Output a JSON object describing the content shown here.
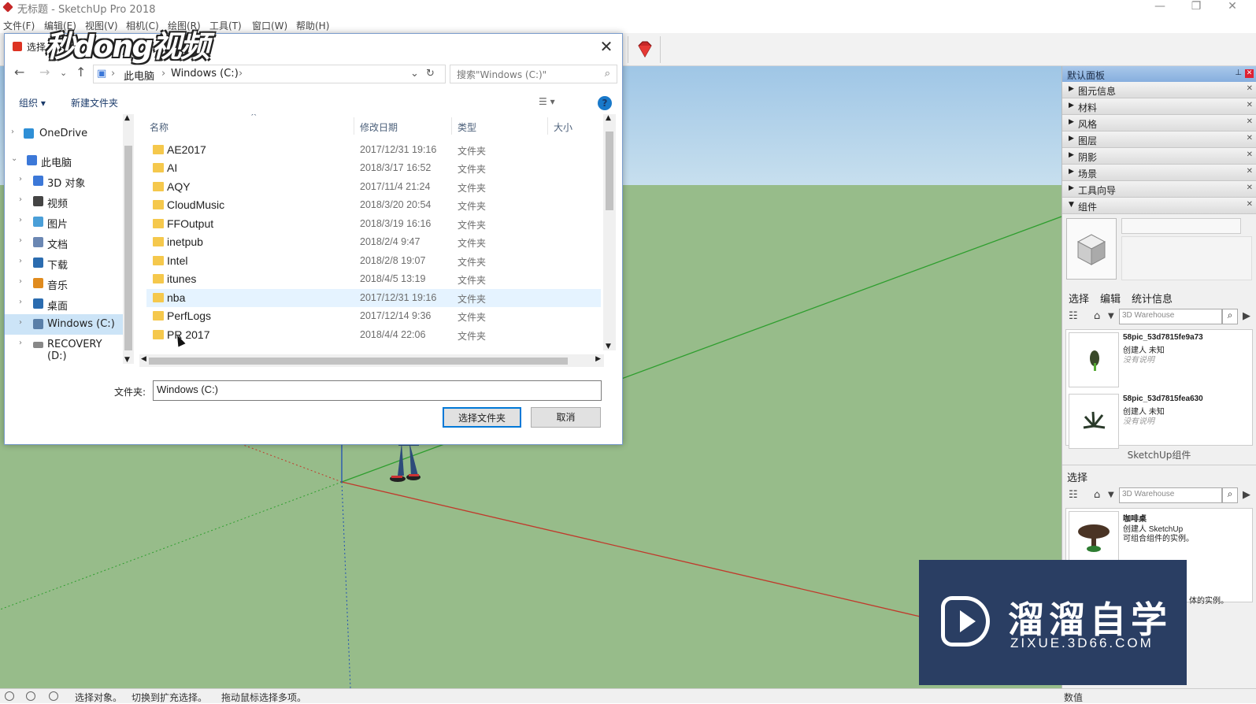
{
  "app": {
    "title": "无标题 - SketchUp Pro 2018"
  },
  "menu": [
    "文件(F)",
    "编辑(E)",
    "视图(V)",
    "相机(C)",
    "绘图(R)",
    "工具(T)",
    "窗口(W)",
    "帮助(H)"
  ],
  "status": {
    "text1": "选择对象。",
    "text2": "切换到扩充选择。",
    "text3": "拖动鼠标选择多项。",
    "value_label": "数值"
  },
  "tray": {
    "title": "默认面板",
    "sections": [
      "图元信息",
      "材料",
      "风格",
      "图层",
      "阴影",
      "场景",
      "工具向导",
      "组件"
    ],
    "tabs": [
      "选择",
      "编辑",
      "统计信息"
    ],
    "search_placeholder": "3D Warehouse",
    "items": [
      {
        "name": "58pic_53d7815fe9a73",
        "author": "创建人 未知",
        "desc": "没有说明"
      },
      {
        "name": "58pic_53d7815fea630",
        "author": "创建人 未知",
        "desc": "没有说明"
      }
    ],
    "footer": "SketchUp组件",
    "select_label": "选择",
    "item2": {
      "name": "咖啡桌",
      "author": "创建人 SketchUp",
      "desc": "可组合组件的实例。"
    },
    "item2_desc_tail": "体的实例。"
  },
  "dialog": {
    "title": "选择",
    "breadcrumb": [
      "此电脑",
      "Windows (C:)"
    ],
    "search_placeholder": "搜索\"Windows (C:)\"",
    "organize": "组织 ▾",
    "new_folder": "新建文件夹",
    "columns": {
      "name": "名称",
      "date": "修改日期",
      "type": "类型",
      "size": "大小"
    },
    "tree": [
      {
        "label": "OneDrive",
        "icon": "cloud-icon",
        "color": "#2f8fd6"
      },
      {
        "label": "此电脑",
        "icon": "computer-icon",
        "color": "#3c78d8"
      },
      {
        "label": "3D 对象",
        "icon": "cube-icon",
        "color": "#3c78d8"
      },
      {
        "label": "视频",
        "icon": "video-icon",
        "color": "#444"
      },
      {
        "label": "图片",
        "icon": "picture-icon",
        "color": "#4a9fd8"
      },
      {
        "label": "文档",
        "icon": "document-icon",
        "color": "#6b87b3"
      },
      {
        "label": "下载",
        "icon": "download-icon",
        "color": "#2b6cb0"
      },
      {
        "label": "音乐",
        "icon": "music-icon",
        "color": "#e08b1e"
      },
      {
        "label": "桌面",
        "icon": "desktop-icon",
        "color": "#2b6cb0"
      },
      {
        "label": "Windows (C:)",
        "icon": "drive-icon",
        "color": "#5a7fa8"
      },
      {
        "label": "RECOVERY (D:)",
        "icon": "drive-icon",
        "color": "#888"
      }
    ],
    "files": [
      {
        "name": "AE2017",
        "date": "2017/12/31 19:16",
        "type": "文件夹"
      },
      {
        "name": "AI",
        "date": "2018/3/17 16:52",
        "type": "文件夹"
      },
      {
        "name": "AQY",
        "date": "2017/11/4 21:24",
        "type": "文件夹"
      },
      {
        "name": "CloudMusic",
        "date": "2018/3/20 20:54",
        "type": "文件夹"
      },
      {
        "name": "FFOutput",
        "date": "2018/3/19 16:16",
        "type": "文件夹"
      },
      {
        "name": "inetpub",
        "date": "2018/2/4 9:47",
        "type": "文件夹"
      },
      {
        "name": "Intel",
        "date": "2018/2/8 19:07",
        "type": "文件夹"
      },
      {
        "name": "itunes",
        "date": "2018/4/5 13:19",
        "type": "文件夹"
      },
      {
        "name": "nba",
        "date": "2017/12/31 19:16",
        "type": "文件夹"
      },
      {
        "name": "PerfLogs",
        "date": "2017/12/14 9:36",
        "type": "文件夹"
      },
      {
        "name": "PR 2017",
        "date": "2018/4/4 22:06",
        "type": "文件夹"
      }
    ],
    "folder_label": "文件夹:",
    "folder_value": "Windows (C:)",
    "select_button": "选择文件夹",
    "cancel_button": "取消"
  },
  "watermarks": {
    "top": "秒dong视频",
    "br_cn": "溜溜自学",
    "br_en": "ZIXUE.3D66.COM"
  },
  "colors": {
    "sky": "#9fc6e6",
    "ground": "#97bc8a",
    "accent": "#0078d7"
  }
}
